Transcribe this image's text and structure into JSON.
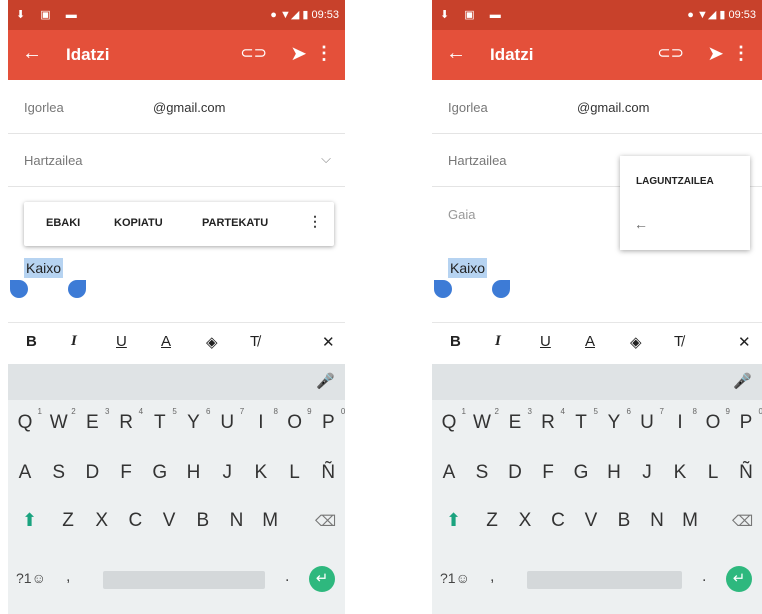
{
  "left": {
    "status_icons_left": "⬇ ▣ ▬",
    "status_right": "● ▼◢ ▮ 09:53",
    "title": "Idatzi",
    "from_label": "Igorlea",
    "from_value": "@gmail.com",
    "to_label": "Hartzailea",
    "context_menu": {
      "cut": "EBAKI",
      "copy": "KOPIATU",
      "share": "PARTEKATU",
      "more": "⋮"
    },
    "selected_text": "Kaixo"
  },
  "right": {
    "status_icons_left": "⬇ ▣ ▬",
    "status_right": "● ▼◢ ▮ 09:53",
    "title": "Idatzi",
    "from_label": "Igorlea",
    "from_value": "@gmail.com",
    "to_label": "Hartzailea",
    "subject_label": "Gaia",
    "popup_title": "LAGUNTZAILEA",
    "popup_back": "←",
    "selected_text": "Kaixo"
  },
  "icons": {
    "back": "←",
    "attach": "⊂⊃",
    "send": "➤",
    "more": "⋮",
    "chevron": "⌵",
    "mic": "🎤"
  },
  "format_bar": {
    "bold": "B",
    "italic": "I",
    "underline": "U",
    "color": "A",
    "fill": "◈",
    "clear": "T̸",
    "close": "✕"
  },
  "keyboard": {
    "row1": [
      [
        "Q",
        "1"
      ],
      [
        "W",
        "2"
      ],
      [
        "E",
        "3"
      ],
      [
        "R",
        "4"
      ],
      [
        "T",
        "5"
      ],
      [
        "Y",
        "6"
      ],
      [
        "U",
        "7"
      ],
      [
        "I",
        "8"
      ],
      [
        "O",
        "9"
      ],
      [
        "P",
        "0"
      ]
    ],
    "row2": [
      "A",
      "S",
      "D",
      "F",
      "G",
      "H",
      "J",
      "K",
      "L",
      "Ñ"
    ],
    "row3": [
      "Z",
      "X",
      "C",
      "V",
      "B",
      "N",
      "M"
    ],
    "shift": "⬆",
    "backspace": "⌫",
    "symbols": "?1☺",
    "comma": ",",
    "period": ".",
    "enter": "↵"
  },
  "colors": {
    "appbar": "#e4503a",
    "status": "#c8412b",
    "selection": "#b6d3f1",
    "handle": "#3d7bd6",
    "enter": "#2eb87e"
  }
}
